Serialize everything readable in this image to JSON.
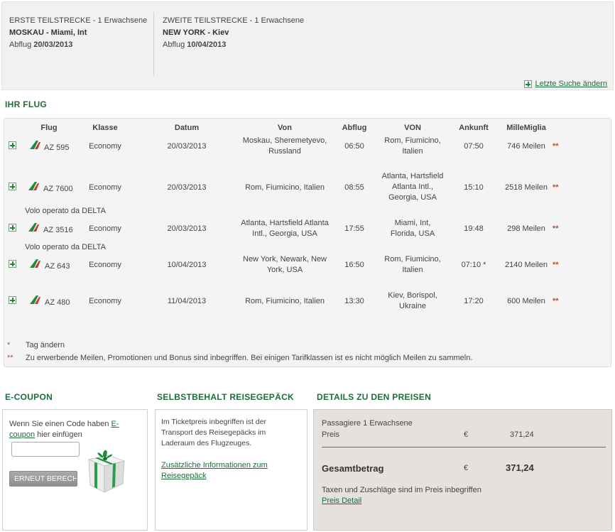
{
  "summary": {
    "segment1": {
      "label": "ERSTE TEILSTRECKE - 1 Erwachsene",
      "route": "MOSKAU - Miami, Int",
      "departure_prefix": "Abflug",
      "departure_date": "20/03/2013"
    },
    "segment2": {
      "label": "ZWEITE TEILSTRECKE - 1 Erwachsene",
      "route": "NEW YORK - Kiev",
      "departure_prefix": "Abflug",
      "departure_date": "10/04/2013"
    },
    "last_search_link": "Letzte Suche ändern"
  },
  "flight_section_title": "IHR FLUG",
  "columns": [
    "Flug",
    "Klasse",
    "Datum",
    "Von",
    "Abflug",
    "VON",
    "Ankunft",
    "MilleMiglia"
  ],
  "flights": [
    {
      "flight": "AZ 595",
      "class": "Economy",
      "date": "20/03/2013",
      "from": "Moskau, Sheremetyevo, Russland",
      "departure": "06:50",
      "to": "Rom, Fiumicino, Italien",
      "arrival": "07:50",
      "miles": "746 Meilen",
      "mark": "**"
    },
    {
      "flight": "AZ 7600",
      "class": "Economy",
      "date": "20/03/2013",
      "from": "Rom, Fiumicino, Italien",
      "departure": "08:55",
      "to": "Atlanta, Hartsfield Atlanta Intl., Georgia, USA",
      "arrival": "15:10",
      "miles": "2518 Meilen",
      "mark": "**",
      "operated": "Volo operato da DELTA"
    },
    {
      "flight": "AZ 3516",
      "class": "Economy",
      "date": "20/03/2013",
      "from": "Atlanta, Hartsfield Atlanta Intl., Georgia, USA",
      "departure": "17:55",
      "to": "Miami, Int, Florida, USA",
      "arrival": "19:48",
      "miles": "298 Meilen",
      "mark": "**",
      "operated": "Volo operato da DELTA"
    },
    {
      "flight": "AZ 643",
      "class": "Economy",
      "date": "10/04/2013",
      "from": "New York, Newark, New York, USA",
      "departure": "16:50",
      "to": "Rom, Fiumicino, Italien",
      "arrival": "07:10 *",
      "miles": "2140 Meilen",
      "mark": "**"
    },
    {
      "flight": "AZ 480",
      "class": "Economy",
      "date": "11/04/2013",
      "from": "Rom, Fiumicino, Italien",
      "departure": "13:30",
      "to": "Kiev, Borispol, Ukraine",
      "arrival": "17:20",
      "miles": "600 Meilen",
      "mark": "**"
    }
  ],
  "notes": [
    {
      "mark": "*",
      "text": "Tag ändern"
    },
    {
      "mark": "**",
      "text": "Zu erwerbende Meilen, Promotionen und Bonus sind inbegriffen. Bei einigen Tarifklassen ist es nicht möglich Meilen zu sammeln."
    }
  ],
  "ecoupon": {
    "title": "E-COUPON",
    "text_before": "Wenn Sie einen Code haben ",
    "link": "E-coupon",
    "text_after": " hier einfügen",
    "input_value": "",
    "button": "ERNEUT BERECHNEN"
  },
  "luggage": {
    "title": "SELBSTBEHALT REISEGEPÄCK",
    "text": "Im Ticketpreis inbegriffen ist der Transport des Reisegepäcks im Laderaum des Flugzeuges.",
    "link": "Zusätzliche Informationen zum Reisegepäck"
  },
  "prices": {
    "title": "DETAILS ZU DEN PREISEN",
    "passengers": "Passagiere 1 Erwachsene",
    "price_label": "Preis",
    "currency": "€",
    "price": "371,24",
    "total_label": "Gesamtbetrag",
    "total": "371,24",
    "tax_note": "Taxen und Zuschläge sind im Preis inbegriffen",
    "detail_link": "Preis Detail"
  },
  "colors": {
    "accent_green": "#1d6e3a",
    "asterisk": "#b8541b",
    "price_bg": "#e6e1dc"
  }
}
